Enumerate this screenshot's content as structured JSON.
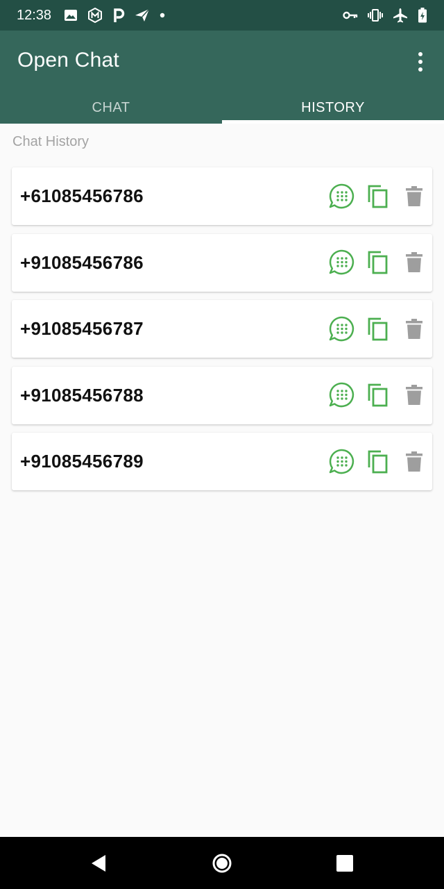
{
  "status_bar": {
    "time": "12:38",
    "left_icons": [
      "image-icon",
      "m-badge-icon",
      "p-icon",
      "send-icon",
      "dot-icon"
    ],
    "right_icons": [
      "vpn-key-icon",
      "vibrate-icon",
      "airplane-icon",
      "battery-charging-icon"
    ]
  },
  "app_bar": {
    "title": "Open Chat",
    "tabs": [
      {
        "label": "CHAT",
        "active": false
      },
      {
        "label": "HISTORY",
        "active": true
      }
    ]
  },
  "history": {
    "section_label": "Chat History",
    "items": [
      {
        "phone": "+61085456786"
      },
      {
        "phone": "+91085456786"
      },
      {
        "phone": "+91085456787"
      },
      {
        "phone": "+91085456788"
      },
      {
        "phone": "+91085456789"
      }
    ],
    "row_actions": [
      "whatsapp-chat-icon",
      "copy-icon",
      "delete-icon"
    ]
  },
  "colors": {
    "status_bar": "#234f45",
    "app_bar": "#35675b",
    "action_green": "#4caf50",
    "delete_gray": "#9e9e9e",
    "background": "#fafafa"
  },
  "nav_bar": {
    "buttons": [
      "back-icon",
      "home-icon",
      "recents-icon"
    ]
  }
}
